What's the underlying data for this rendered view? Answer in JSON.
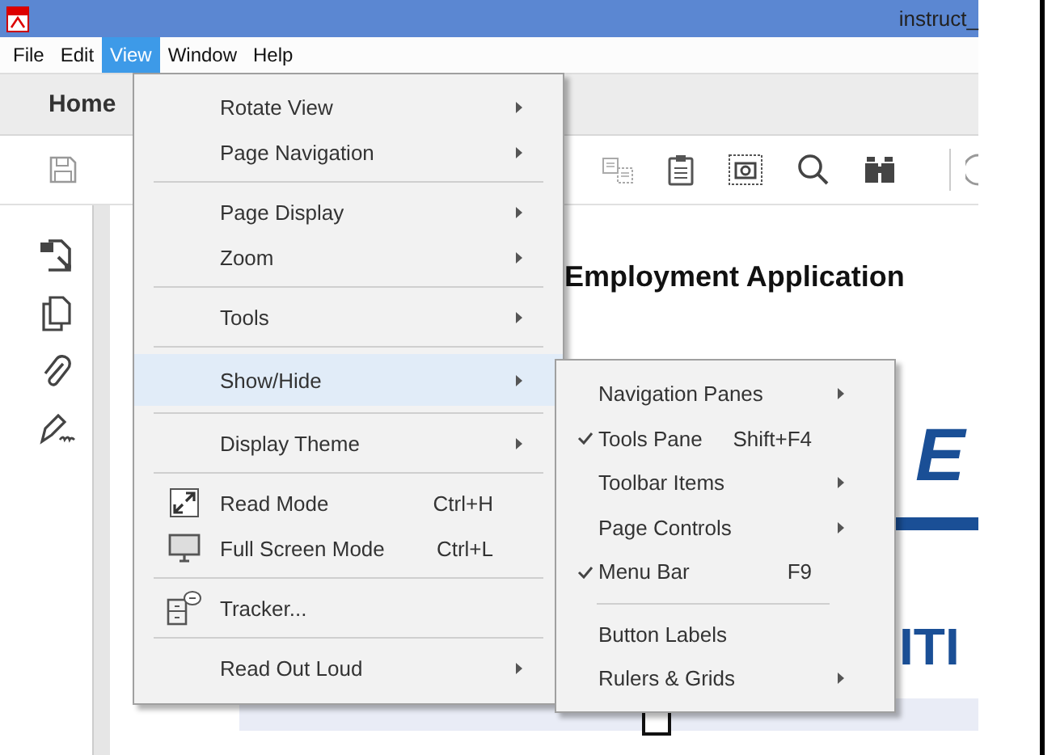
{
  "window": {
    "title": "instruct_"
  },
  "menu_bar": [
    {
      "label": "File",
      "selected": false
    },
    {
      "label": "Edit",
      "selected": false
    },
    {
      "label": "View",
      "selected": true
    },
    {
      "label": "Window",
      "selected": false
    },
    {
      "label": "Help",
      "selected": false
    }
  ],
  "tabs": [
    {
      "label": "Home"
    }
  ],
  "document": {
    "heading": "Employment Application",
    "banner_letter": "E",
    "section_text": "ITI",
    "checkbox_checked": false
  },
  "view_menu": {
    "items": [
      {
        "kind": "submenu",
        "label": "Rotate View",
        "selected": false
      },
      {
        "kind": "submenu",
        "label": "Page Navigation",
        "selected": false
      },
      {
        "kind": "separator"
      },
      {
        "kind": "submenu",
        "label": "Page Display",
        "selected": false
      },
      {
        "kind": "submenu",
        "label": "Zoom",
        "selected": false
      },
      {
        "kind": "separator"
      },
      {
        "kind": "submenu",
        "label": "Tools",
        "selected": false
      },
      {
        "kind": "separator"
      },
      {
        "kind": "submenu",
        "label": "Show/Hide",
        "selected": true
      },
      {
        "kind": "separator"
      },
      {
        "kind": "submenu",
        "label": "Display Theme",
        "selected": false
      },
      {
        "kind": "separator"
      },
      {
        "kind": "readmode",
        "label": "Read Mode",
        "shortcut": "Ctrl+H",
        "selected": false
      },
      {
        "kind": "fullscreen",
        "label": "Full Screen Mode",
        "shortcut": "Ctrl+L",
        "selected": false
      },
      {
        "kind": "separator"
      },
      {
        "kind": "tracker",
        "label": "Tracker...",
        "selected": false
      },
      {
        "kind": "separator"
      },
      {
        "kind": "submenu",
        "label": "Read Out Loud",
        "selected": false
      }
    ]
  },
  "show_hide_menu": {
    "items": [
      {
        "kind": "submenu",
        "label": "Navigation Panes",
        "checked": false
      },
      {
        "kind": "command",
        "label": "Tools Pane",
        "shortcut": "Shift+F4",
        "checked": true
      },
      {
        "kind": "submenu",
        "label": "Toolbar Items",
        "checked": false
      },
      {
        "kind": "submenu",
        "label": "Page Controls",
        "checked": false
      },
      {
        "kind": "command",
        "label": "Menu Bar",
        "shortcut": "F9",
        "checked": true
      },
      {
        "kind": "separator"
      },
      {
        "kind": "command",
        "label": "Button Labels",
        "checked": false
      },
      {
        "kind": "submenu",
        "label": "Rulers & Grids",
        "checked": false
      }
    ]
  }
}
